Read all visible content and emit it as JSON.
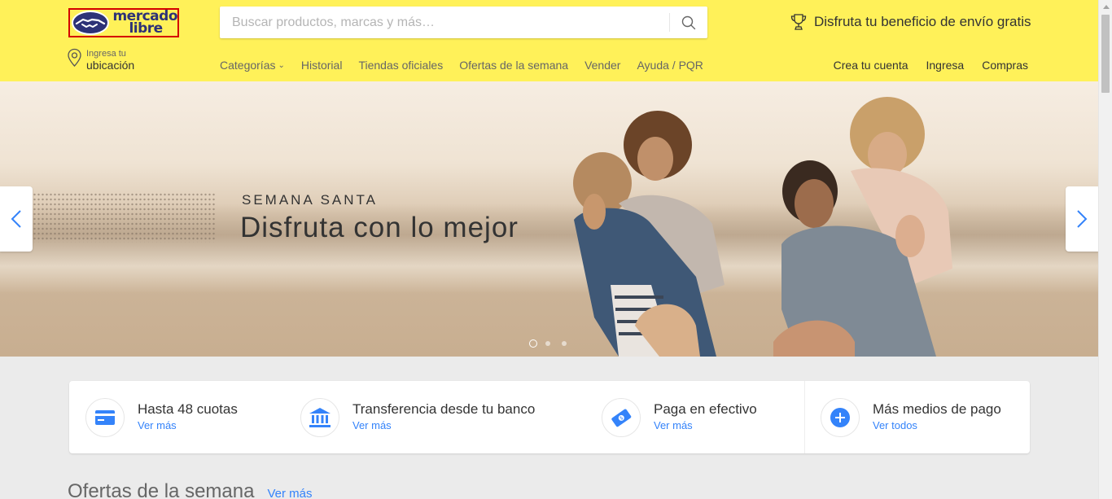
{
  "logo": {
    "line1": "mercado",
    "line2": "libre"
  },
  "search": {
    "placeholder": "Buscar productos, marcas y más…",
    "value": ""
  },
  "promo": {
    "icon": "trophy-icon",
    "text": "Disfruta tu beneficio de envío gratis"
  },
  "location": {
    "line1": "Ingresa tu",
    "line2": "ubicación"
  },
  "nav": {
    "categories": "Categorías",
    "history": "Historial",
    "official_stores": "Tiendas oficiales",
    "weekly_offers": "Ofertas de la semana",
    "sell": "Vender",
    "help": "Ayuda / PQR"
  },
  "user_nav": {
    "create_account": "Crea tu cuenta",
    "login": "Ingresa",
    "purchases": "Compras"
  },
  "hero": {
    "kicker": "SEMANA SANTA",
    "title": "Disfruta con lo mejor",
    "slides": 3,
    "active_slide": 1
  },
  "payments": [
    {
      "title": "Hasta 48 cuotas",
      "link": "Ver más",
      "icon": "credit-card-icon"
    },
    {
      "title": "Transferencia desde tu banco",
      "link": "Ver más",
      "icon": "bank-icon"
    },
    {
      "title": "Paga en efectivo",
      "link": "Ver más",
      "icon": "cash-icon"
    },
    {
      "title": "Más medios de pago",
      "link": "Ver todos",
      "icon": "plus-circle-icon"
    }
  ],
  "offers": {
    "title": "Ofertas de la semana",
    "link": "Ver más"
  },
  "colors": {
    "header": "#fff159",
    "brand_blue": "#2d3277",
    "link_blue": "#3483fa",
    "background": "#ebebeb"
  }
}
